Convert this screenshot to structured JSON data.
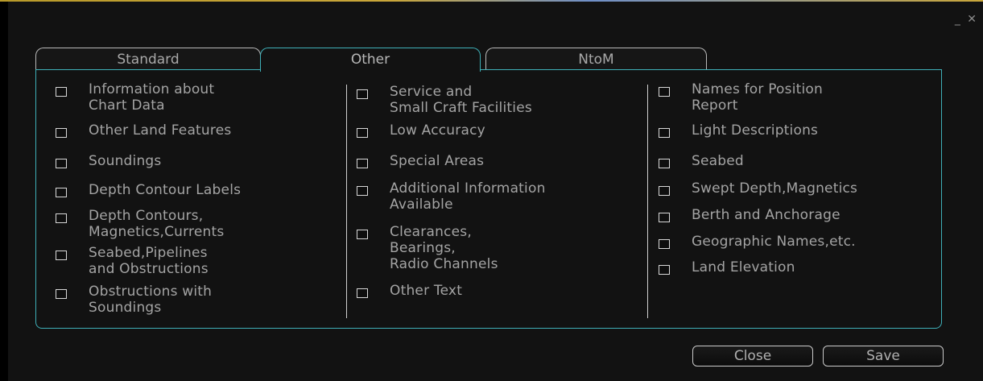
{
  "window": {
    "controls": "_ ✕"
  },
  "tabs": [
    {
      "label": "Standard",
      "active": false
    },
    {
      "label": "Other",
      "active": true
    },
    {
      "label": "NtoM",
      "active": false
    }
  ],
  "columns": [
    [
      {
        "label": "Information about\nChart Data",
        "checked": false
      },
      {
        "label": "Other Land Features",
        "checked": false
      },
      {
        "label": "Soundings",
        "checked": false
      },
      {
        "label": "Depth Contour Labels",
        "checked": false
      },
      {
        "label": "Depth Contours,\nMagnetics,Currents",
        "checked": false
      },
      {
        "label": "Seabed,Pipelines\nand Obstructions",
        "checked": false
      },
      {
        "label": "Obstructions with\nSoundings",
        "checked": false
      }
    ],
    [
      {
        "label": "Service and\nSmall Craft Facilities",
        "checked": false
      },
      {
        "label": "Low Accuracy",
        "checked": false
      },
      {
        "label": "Special Areas",
        "checked": false
      },
      {
        "label": "Additional Information\nAvailable",
        "checked": false
      },
      {
        "label": "Clearances,\nBearings,\nRadio Channels",
        "checked": false
      },
      {
        "label": "Other Text",
        "checked": false
      }
    ],
    [
      {
        "label": "Names for Position\nReport",
        "checked": false
      },
      {
        "label": "Light Descriptions",
        "checked": false
      },
      {
        "label": "Seabed",
        "checked": false
      },
      {
        "label": "Swept Depth,Magnetics",
        "checked": false
      },
      {
        "label": "Berth and Anchorage",
        "checked": false
      },
      {
        "label": "Geographic Names,etc.",
        "checked": false
      },
      {
        "label": "Land Elevation",
        "checked": false
      }
    ]
  ],
  "buttons": {
    "close": "Close",
    "save": "Save"
  }
}
